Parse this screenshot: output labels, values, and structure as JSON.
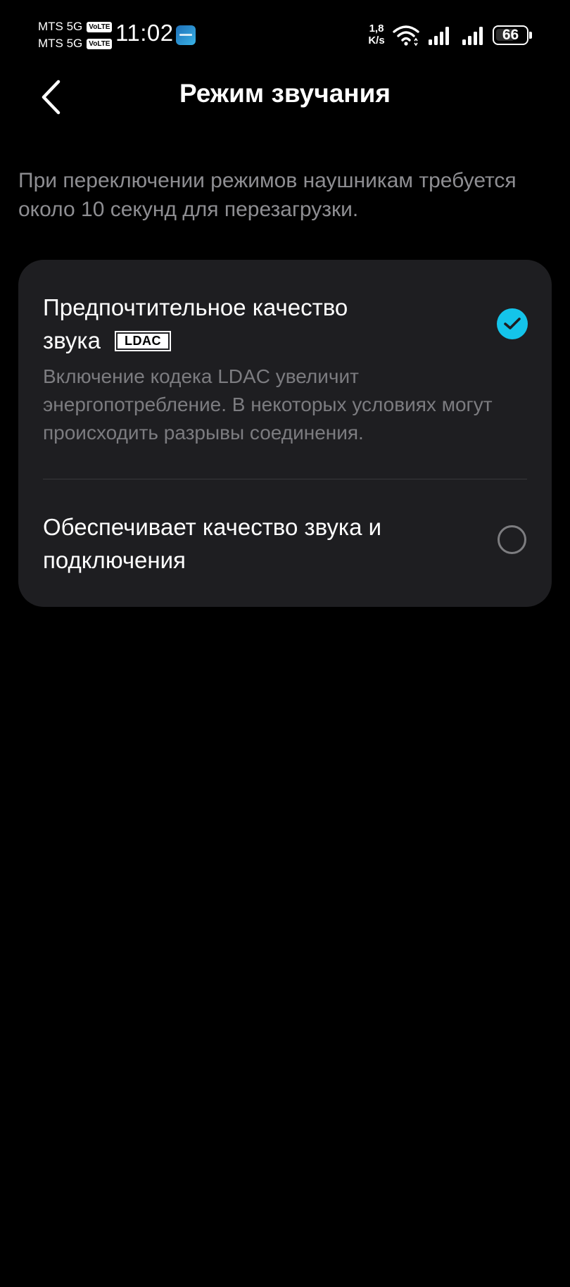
{
  "status_bar": {
    "carrier_1": "MTS 5G",
    "carrier_1_badge": "VoLTE",
    "carrier_2": "MTS 5G",
    "carrier_2_badge": "VoLTE",
    "time": "11:02",
    "app_icon": "amber-weather-icon",
    "net_speed_value": "1,8",
    "net_speed_unit": "K/s",
    "wifi_icon": "wifi-icon",
    "signal_icon": "signal-bars-icon",
    "battery_level": "66",
    "battery_fraction": 0.66
  },
  "header": {
    "back_icon": "chevron-left-icon",
    "title": "Режим звучания"
  },
  "description": "При переключении режимов наушникам требуется около 10 секунд для перезагрузки.",
  "options": [
    {
      "title_line_1": "Предпочтительное качество",
      "title_line_2": "звука",
      "badge": "LDAC",
      "description": "Включение кодека LDAC увеличит энергопотребление. В некоторых условиях могут происходить разрывы соединения.",
      "selected": true
    },
    {
      "title_line_1": "Обеспечивает качество звука и",
      "title_line_2": "подключения",
      "selected": false
    }
  ],
  "colors": {
    "background": "#000000",
    "card": "#1e1e21",
    "accent": "#14c4ea",
    "secondary_text": "#8e8e92",
    "divider": "#38383c"
  }
}
